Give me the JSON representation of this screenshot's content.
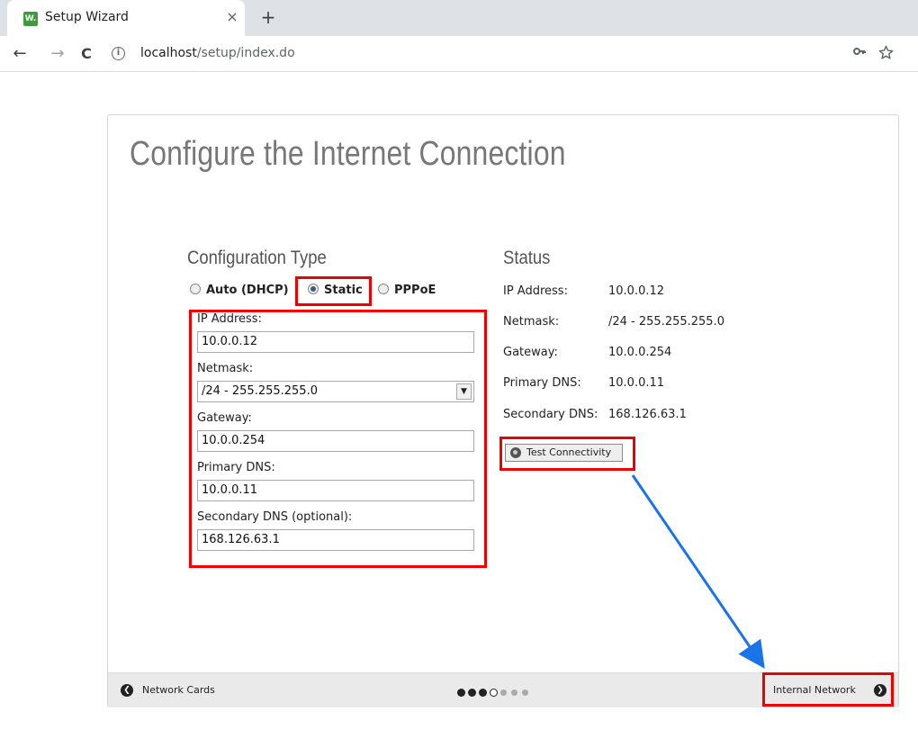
{
  "browser": {
    "tab_title": "Setup Wizard",
    "favicon_text": "W.",
    "close_glyph": "×",
    "new_tab_glyph": "+",
    "url_host": "localhost",
    "url_path": "/setup/index.do",
    "back_glyph": "←",
    "forward_glyph": "→",
    "reload_glyph": "C",
    "info_glyph": "i",
    "key_icon": "key-icon",
    "star_icon": "star-icon"
  },
  "page": {
    "title": "Configure the Internet Connection"
  },
  "config": {
    "heading": "Configuration Type",
    "options": [
      {
        "label": "Auto (DHCP)",
        "checked": false
      },
      {
        "label": "Static",
        "checked": true
      },
      {
        "label": "PPPoE",
        "checked": false
      }
    ],
    "fields": {
      "ip_label": "IP Address:",
      "ip_value": "10.0.0.12",
      "netmask_label": "Netmask:",
      "netmask_value": "/24 - 255.255.255.0",
      "gateway_label": "Gateway:",
      "gateway_value": "10.0.0.254",
      "dns1_label": "Primary DNS:",
      "dns1_value": "10.0.0.11",
      "dns2_label": "Secondary DNS (optional):",
      "dns2_value": "168.126.63.1"
    }
  },
  "status": {
    "heading": "Status",
    "rows": [
      {
        "label": "IP Address:",
        "value": "10.0.0.12"
      },
      {
        "label": "Netmask:",
        "value": "/24 - 255.255.255.0"
      },
      {
        "label": "Gateway:",
        "value": "10.0.0.254"
      },
      {
        "label": "Primary DNS:",
        "value": "10.0.0.11"
      },
      {
        "label": "Secondary DNS:",
        "value": "168.126.63.1"
      }
    ],
    "test_button": "Test Connectivity"
  },
  "footer": {
    "prev_label": "Network Cards",
    "next_label": "Internal Network",
    "prev_glyph": "❮",
    "next_glyph": "❯",
    "steps_total": 7,
    "step_current": 4
  },
  "colors": {
    "highlight": "#ee0000",
    "arrow": "#1a73e8"
  }
}
